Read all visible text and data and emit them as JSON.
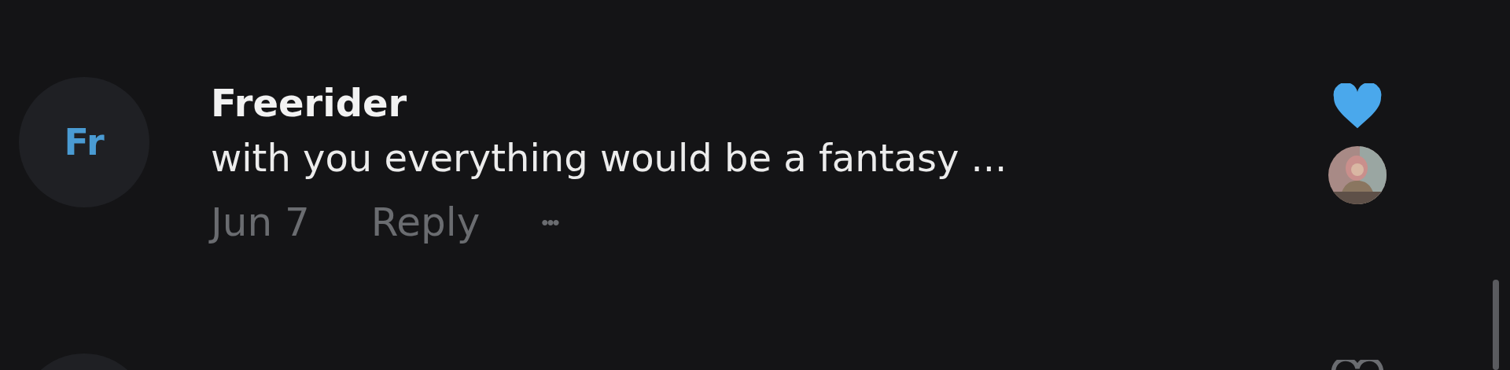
{
  "comments": [
    {
      "initials": "Fr",
      "author": "Freerider",
      "text": "with you everything would be a fantasy ...",
      "date": "Jun 7",
      "reply": "Reply",
      "more": "•••",
      "liked": true,
      "liked_by_creator": true
    },
    {
      "liked": false
    }
  ]
}
